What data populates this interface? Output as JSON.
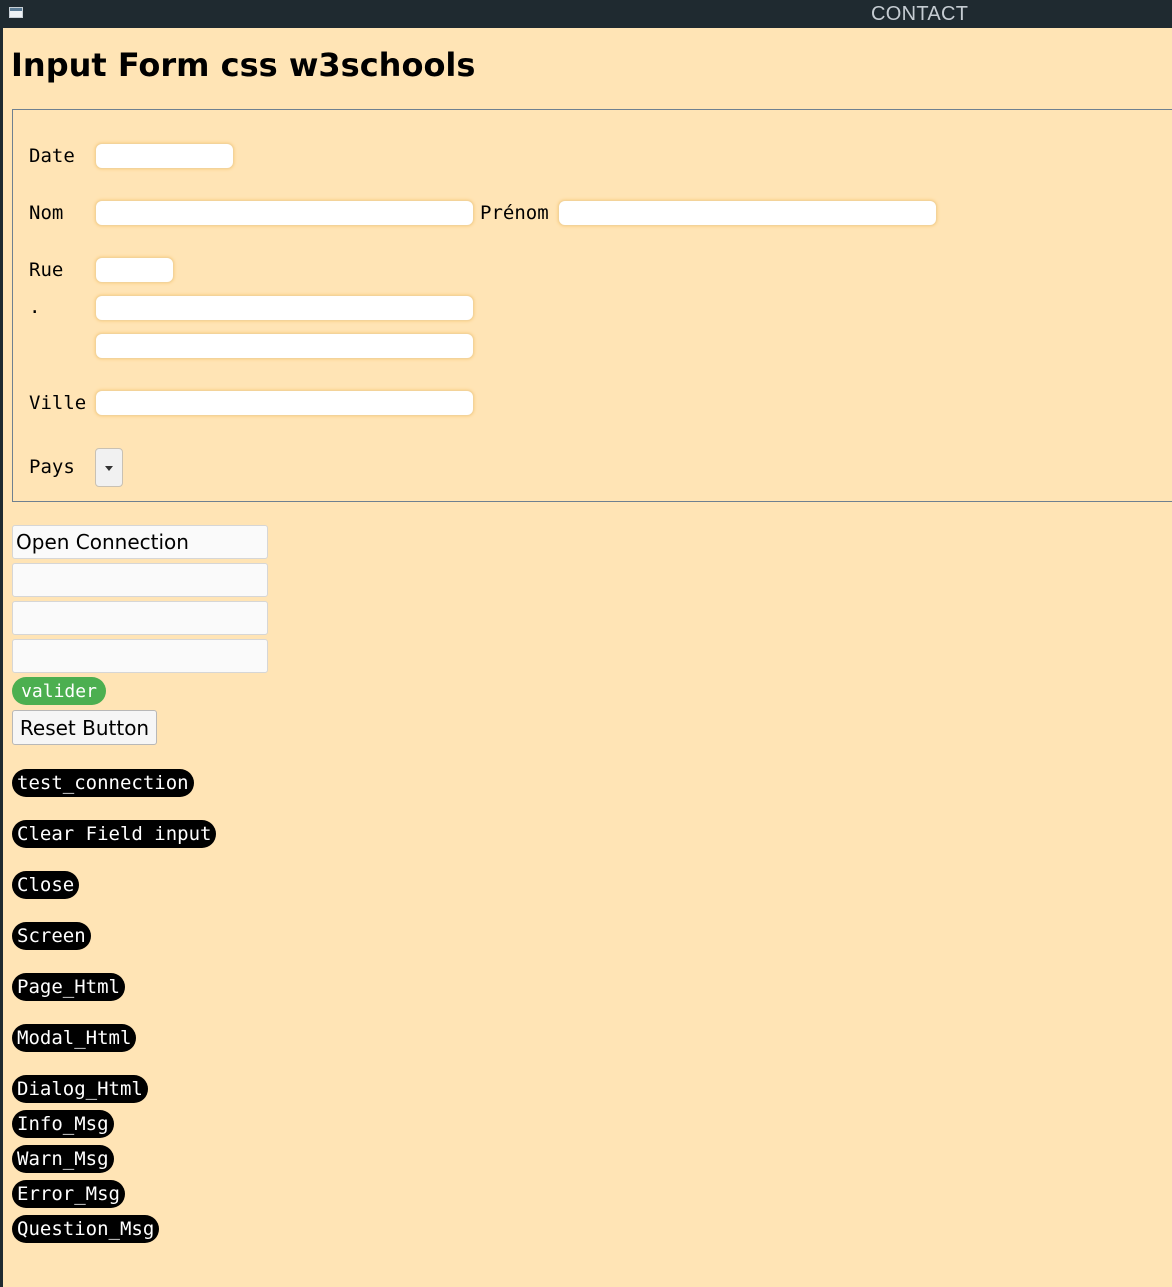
{
  "window": {
    "title": "CONTACT"
  },
  "page": {
    "heading": "Input Form css w3schools"
  },
  "form": {
    "date_label": "Date",
    "nom_label": "Nom",
    "prenom_label": "Prénom",
    "rue_label": "Rue",
    "rue_dot_label": ".",
    "ville_label": "Ville",
    "pays_label": "Pays",
    "date_value": "",
    "nom_value": "",
    "prenom_value": "",
    "rue_value": "",
    "rue2_value": "",
    "rue3_value": "",
    "ville_value": "",
    "pays_value": ""
  },
  "connection": {
    "open_connection_value": "Open Connection",
    "field2_value": "",
    "field3_value": "",
    "field4_value": ""
  },
  "buttons": {
    "valider": "valider",
    "reset": "Reset Button",
    "test_connection": "test_connection",
    "clear_field_input": "Clear Field input",
    "close": "Close",
    "screen": "Screen",
    "page_html": "Page_Html",
    "modal_html": "Modal_Html",
    "dialog_html": "Dialog_Html",
    "info_msg": "Info_Msg",
    "warn_msg": "Warn_Msg",
    "error_msg": "Error_Msg",
    "question_msg": "Question_Msg"
  },
  "colors": {
    "background": "#ffe4b5",
    "titlebar": "#1f2a30",
    "accent_green": "#4caf50",
    "pill_black": "#000000"
  }
}
